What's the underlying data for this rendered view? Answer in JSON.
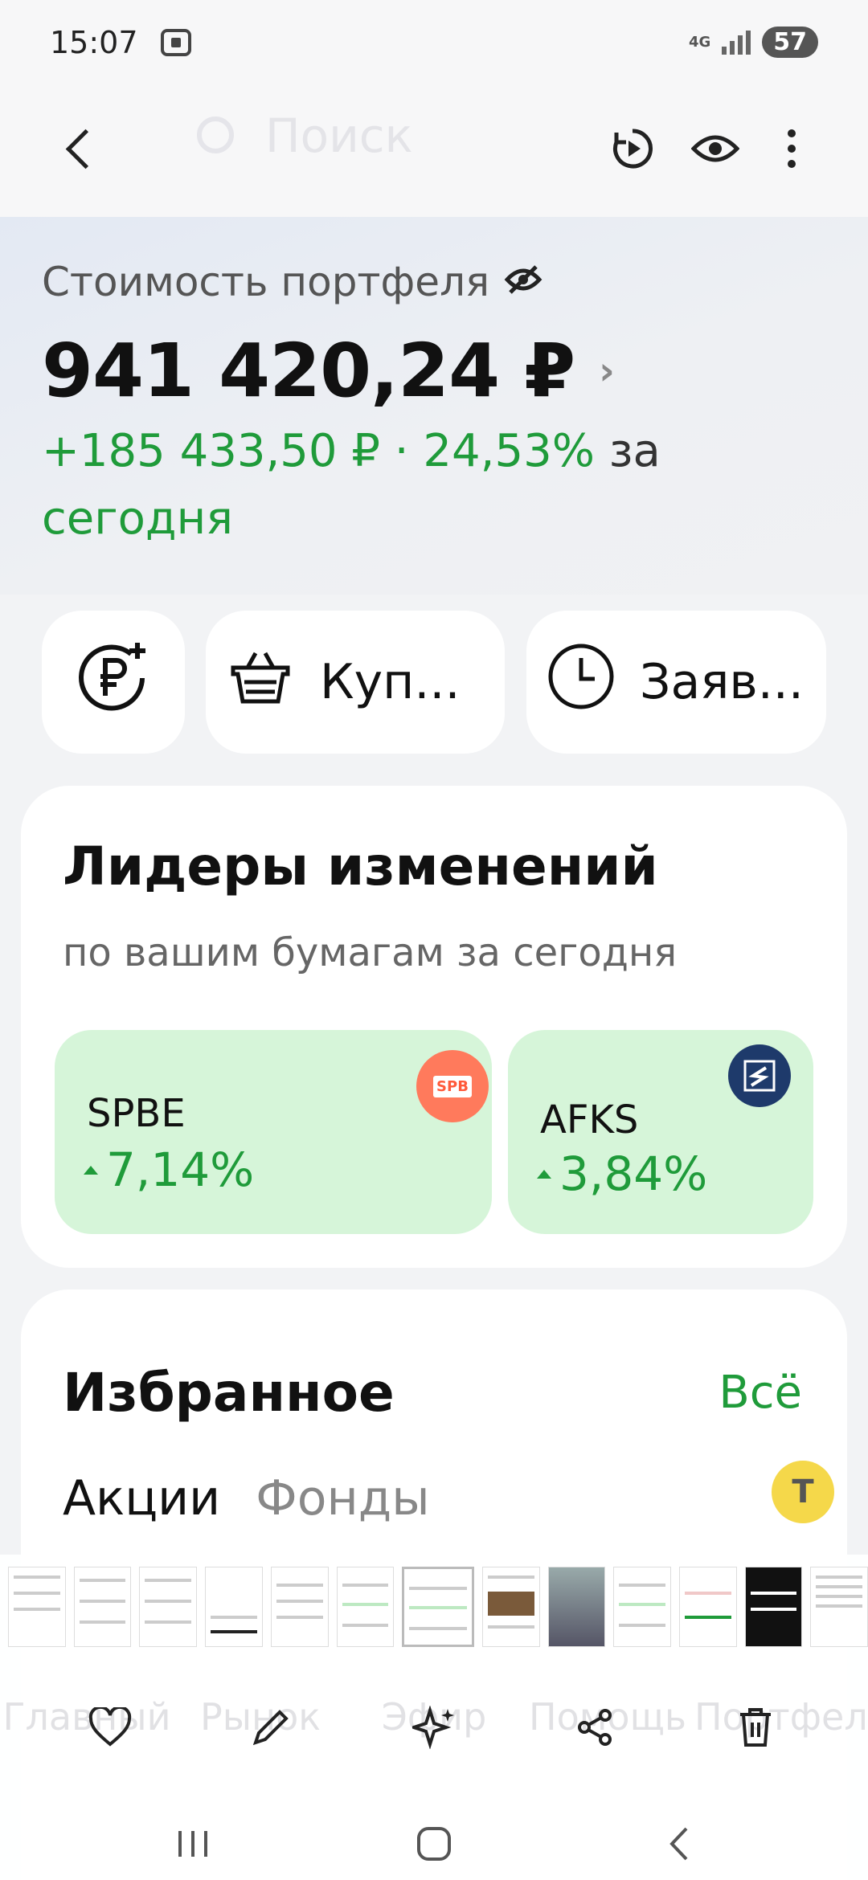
{
  "status_bar": {
    "time": "15:07",
    "network": "4G",
    "battery": "57"
  },
  "top_bar": {
    "search_placeholder": "Поиск"
  },
  "portfolio": {
    "label": "Стоимость портфеля",
    "value": "941 420,24 ₽",
    "change": "+185 433,50 ₽ · 24,53%",
    "change_suffix": "за",
    "change_period": "сегодня"
  },
  "actions": {
    "buy_label": "Куп...",
    "orders_label": "Заяв..."
  },
  "leaders": {
    "title": "Лидеры изменений",
    "subtitle": "по вашим бумагам за сегодня",
    "items": [
      {
        "ticker": "SPBE",
        "change": "7,14%",
        "logo_text": "SPB"
      },
      {
        "ticker": "AFKS",
        "change": "3,84%"
      }
    ]
  },
  "favorites": {
    "title": "Избранное",
    "all_label": "Всё",
    "tabs": [
      "Акции",
      "Фонды"
    ]
  },
  "bottom_nav_ghost": [
    "Главный",
    "Рынок",
    "Эфир",
    "Помощь",
    "Портфель"
  ],
  "colors": {
    "accent_green": "#1f9b3a",
    "tile_green": "#d6f5d9",
    "spbe_logo": "#ff7a5c",
    "afks_logo": "#1e3a6b"
  }
}
